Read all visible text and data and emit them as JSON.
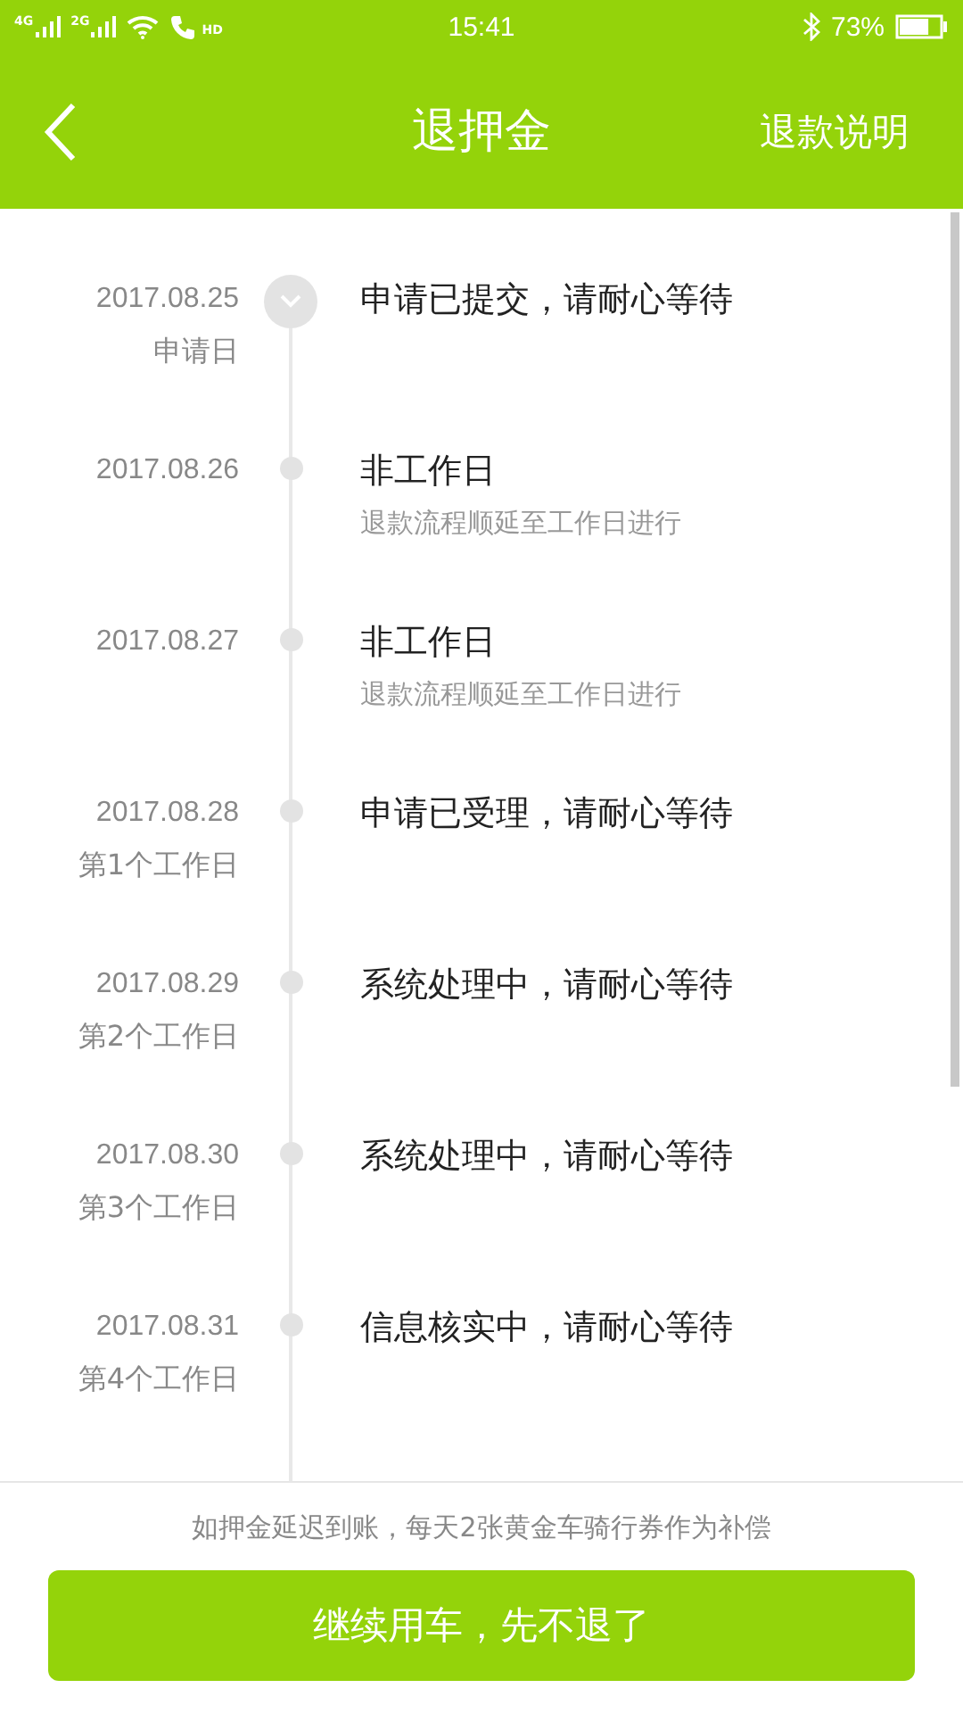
{
  "status_bar": {
    "networks": [
      "4G",
      "2G"
    ],
    "call": "HD",
    "time": "15:41",
    "battery": "73%"
  },
  "header": {
    "title": "退押金",
    "action": "退款说明"
  },
  "timeline": [
    {
      "date": "2017.08.25",
      "day": "申请日",
      "title": "申请已提交，请耐心等待",
      "current": true
    },
    {
      "date": "2017.08.26",
      "title": "非工作日",
      "note": "退款流程顺延至工作日进行",
      "current": false
    },
    {
      "date": "2017.08.27",
      "title": "非工作日",
      "note": "退款流程顺延至工作日进行",
      "current": false
    },
    {
      "date": "2017.08.28",
      "day": "第1个工作日",
      "title": "申请已受理，请耐心等待",
      "current": false
    },
    {
      "date": "2017.08.29",
      "day": "第2个工作日",
      "title": "系统处理中，请耐心等待",
      "current": false
    },
    {
      "date": "2017.08.30",
      "day": "第3个工作日",
      "title": "系统处理中，请耐心等待",
      "current": false
    },
    {
      "date": "2017.08.31",
      "day": "第4个工作日",
      "title": "信息核实中，请耐心等待",
      "current": false
    }
  ],
  "footer": {
    "note": "如押金延迟到账，每天2张黄金车骑行券作为补偿",
    "button": "继续用车，先不退了"
  }
}
